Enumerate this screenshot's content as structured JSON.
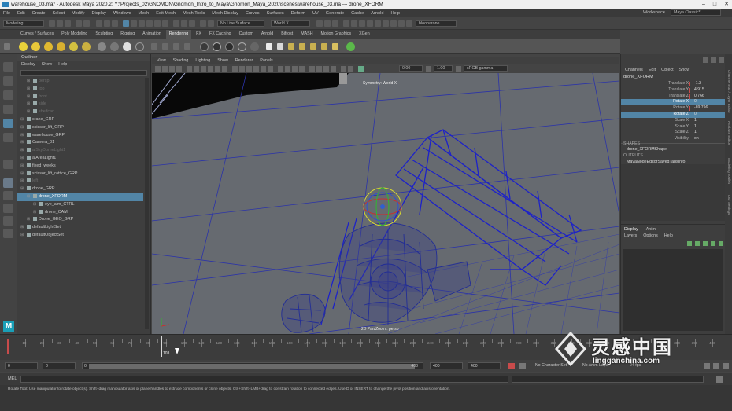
{
  "window": {
    "title": "warehouse_03.ma* - Autodesk Maya 2020.2: Y:\\Projects_02\\GNOMON\\Gnomon_Intro_to_Maya\\Gnomon_Maya_2020\\scenes\\warehouse_03.ma  ---  drone_XFORM",
    "controls": [
      "–",
      "□",
      "✕"
    ]
  },
  "menubar": {
    "items": [
      "File",
      "Edit",
      "Create",
      "Select",
      "Modify",
      "Display",
      "Windows",
      "Mesh",
      "Edit Mesh",
      "Mesh Tools",
      "Mesh Display",
      "Curves",
      "Surfaces",
      "Deform",
      "UV",
      "Generate",
      "Cache",
      "Arnold",
      "Help"
    ],
    "workspace_label": "Workspace :",
    "workspace_value": "Maya Classic*"
  },
  "statusline": {
    "mode": "Modeling",
    "live_surface": "No Live Surface",
    "symmetry": "World X",
    "camera_field": "blooparone"
  },
  "shelf_tabs": [
    "Curves / Surfaces",
    "Poly Modeling",
    "Sculpting",
    "Rigging",
    "Animation",
    "Rendering",
    "FX",
    "FX Caching",
    "Custom",
    "Arnold",
    "Bifrost",
    "MASH",
    "Motion Graphics",
    "XGen"
  ],
  "shelf_active": "Rendering",
  "outliner": {
    "title": "Outliner",
    "menu": [
      "Display",
      "Show",
      "Help"
    ],
    "items": [
      {
        "label": "persp",
        "indent": 1,
        "dim": true
      },
      {
        "label": "top",
        "indent": 1,
        "dim": true
      },
      {
        "label": "front",
        "indent": 1,
        "dim": true
      },
      {
        "label": "side",
        "indent": 1,
        "dim": true
      },
      {
        "label": "shelfcar",
        "indent": 1,
        "dim": true
      },
      {
        "label": "crane_GRP",
        "indent": 0,
        "dim": false
      },
      {
        "label": "scissor_lift_GRP",
        "indent": 0,
        "dim": false
      },
      {
        "label": "warehouse_GRP",
        "indent": 0,
        "dim": false
      },
      {
        "label": "Camera_01",
        "indent": 0,
        "dim": false
      },
      {
        "label": "aiSkyDomeLight1",
        "indent": 0,
        "dim": true
      },
      {
        "label": "aiAreaLight1",
        "indent": 0,
        "dim": false
      },
      {
        "label": "fixed_weeks",
        "indent": 0,
        "dim": false
      },
      {
        "label": "scissor_lift_rattice_GRP",
        "indent": 0,
        "dim": false
      },
      {
        "label": "left",
        "indent": 0,
        "dim": true
      },
      {
        "label": "drone_GRP",
        "indent": 0,
        "dim": false
      },
      {
        "label": "drone_XFORM",
        "indent": 1,
        "dim": false,
        "selected": true
      },
      {
        "label": "eye_aim_CTRL",
        "indent": 2,
        "dim": false
      },
      {
        "label": "drone_CAM",
        "indent": 2,
        "dim": false
      },
      {
        "label": "Drone_GEO_GRP",
        "indent": 1,
        "dim": false
      },
      {
        "label": "defaultLightSet",
        "indent": 0,
        "dim": false
      },
      {
        "label": "defaultObjectSet",
        "indent": 0,
        "dim": false
      }
    ]
  },
  "viewport": {
    "menu": [
      "View",
      "Shading",
      "Lighting",
      "Show",
      "Renderer",
      "Panels"
    ],
    "exposure": "0.00",
    "gamma": "1.00",
    "colorspace": "sRGB gamma",
    "symmetry_hud": "Symmetry: World X",
    "camera_hud": "2D Pan/Zoom : persp"
  },
  "channelbox": {
    "menu": [
      "Channels",
      "Edit",
      "Object",
      "Show"
    ],
    "node": "drone_XFORM",
    "attrs": [
      {
        "name": "Translate X",
        "value": "-1.3",
        "keyed": true,
        "hl": false
      },
      {
        "name": "Translate Y",
        "value": "4.915",
        "keyed": true,
        "hl": false
      },
      {
        "name": "Translate Z",
        "value": "0.766",
        "keyed": true,
        "hl": false
      },
      {
        "name": "Rotate X",
        "value": "0",
        "keyed": false,
        "hl": true
      },
      {
        "name": "Rotate Y",
        "value": "-89.796",
        "keyed": true,
        "hl": false
      },
      {
        "name": "Rotate Z",
        "value": "0",
        "keyed": false,
        "hl": true
      },
      {
        "name": "Scale X",
        "value": "1",
        "keyed": false,
        "hl": false
      },
      {
        "name": "Scale Y",
        "value": "1",
        "keyed": false,
        "hl": false
      },
      {
        "name": "Scale Z",
        "value": "1",
        "keyed": false,
        "hl": false
      },
      {
        "name": "Visibility",
        "value": "on",
        "keyed": false,
        "hl": false
      }
    ],
    "shapes_header": "SHAPES",
    "shape_node": "drone_XFORMShape",
    "outputs_header": "OUTPUTS",
    "output_node": "MayaNodeEditorSavedTabsInfo",
    "layer_tabs": [
      "Display",
      "Anim"
    ],
    "layer_menu": [
      "Layers",
      "Options",
      "Help"
    ],
    "side_tabs": [
      "Channel Box / Layer Editor",
      "Attribute Editor",
      "Modeling Toolkit",
      "Tool Settings"
    ]
  },
  "timeslider": {
    "labels": [
      "10",
      "20",
      "30",
      "40",
      "50",
      "60",
      "70",
      "80",
      "90",
      "100",
      "110",
      "120",
      "130",
      "140",
      "150",
      "160",
      "170",
      "180",
      "190",
      "200",
      "210",
      "220",
      "230",
      "240",
      "250",
      "260",
      "270",
      "280",
      "290",
      "300",
      "310",
      "320",
      "330",
      "340",
      "350",
      "360",
      "370",
      "380",
      "390",
      "400"
    ],
    "current_frame": "103"
  },
  "rangebar": {
    "start": "0",
    "anim_start": "0",
    "range_start": "0",
    "range_end": "400",
    "anim_end": "400",
    "end": "400",
    "character_set": "No Character Set",
    "anim_layer": "No Anim Layer",
    "fps": "24 fps"
  },
  "mel": {
    "label": "MEL"
  },
  "helpline": {
    "text": "Rotate Tool: Use manipulator to rotate object(s). Shift+drag manipulator axis or plane handles to extrude components or clone objects. Ctrl+Shift+LMB+drag to constrain rotation to connected edges. Use D or INSERT to change the pivot position and axis orientation."
  },
  "watermark": {
    "text": "灵感中国",
    "url": "lingganchina.com"
  }
}
